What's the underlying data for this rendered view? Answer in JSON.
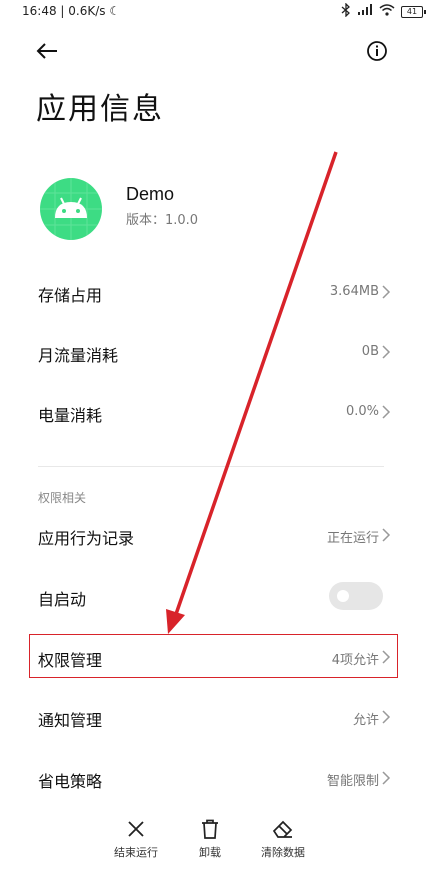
{
  "status_bar": {
    "time_speed": "16:48 | 0.6K/s",
    "battery": "41"
  },
  "header": {
    "title": "应用信息"
  },
  "app": {
    "name": "Demo",
    "version": "版本：1.0.0",
    "icon": "android-icon"
  },
  "usage_rows": [
    {
      "label": "存储占用",
      "value": "3.64MB"
    },
    {
      "label": "月流量消耗",
      "value": "0B"
    },
    {
      "label": "电量消耗",
      "value": "0.0%"
    }
  ],
  "permissions_section": {
    "header": "权限相关",
    "behavior_record": {
      "label": "应用行为记录",
      "value": "正在运行"
    },
    "auto_start": {
      "label": "自启动",
      "enabled": false
    },
    "permission_mgmt": {
      "label": "权限管理",
      "value": "4项允许"
    },
    "notification_mgmt": {
      "label": "通知管理",
      "value": "允许"
    },
    "power_policy": {
      "label": "省电策略",
      "value": "智能限制"
    }
  },
  "bottom_actions": [
    {
      "label": "结束运行",
      "icon": "close-icon"
    },
    {
      "label": "卸载",
      "icon": "trash-icon"
    },
    {
      "label": "清除数据",
      "icon": "eraser-icon"
    }
  ],
  "colors": {
    "highlight": "#d8232a",
    "arrow": "#d8232a",
    "app_icon_bg": "#3ddc84"
  }
}
